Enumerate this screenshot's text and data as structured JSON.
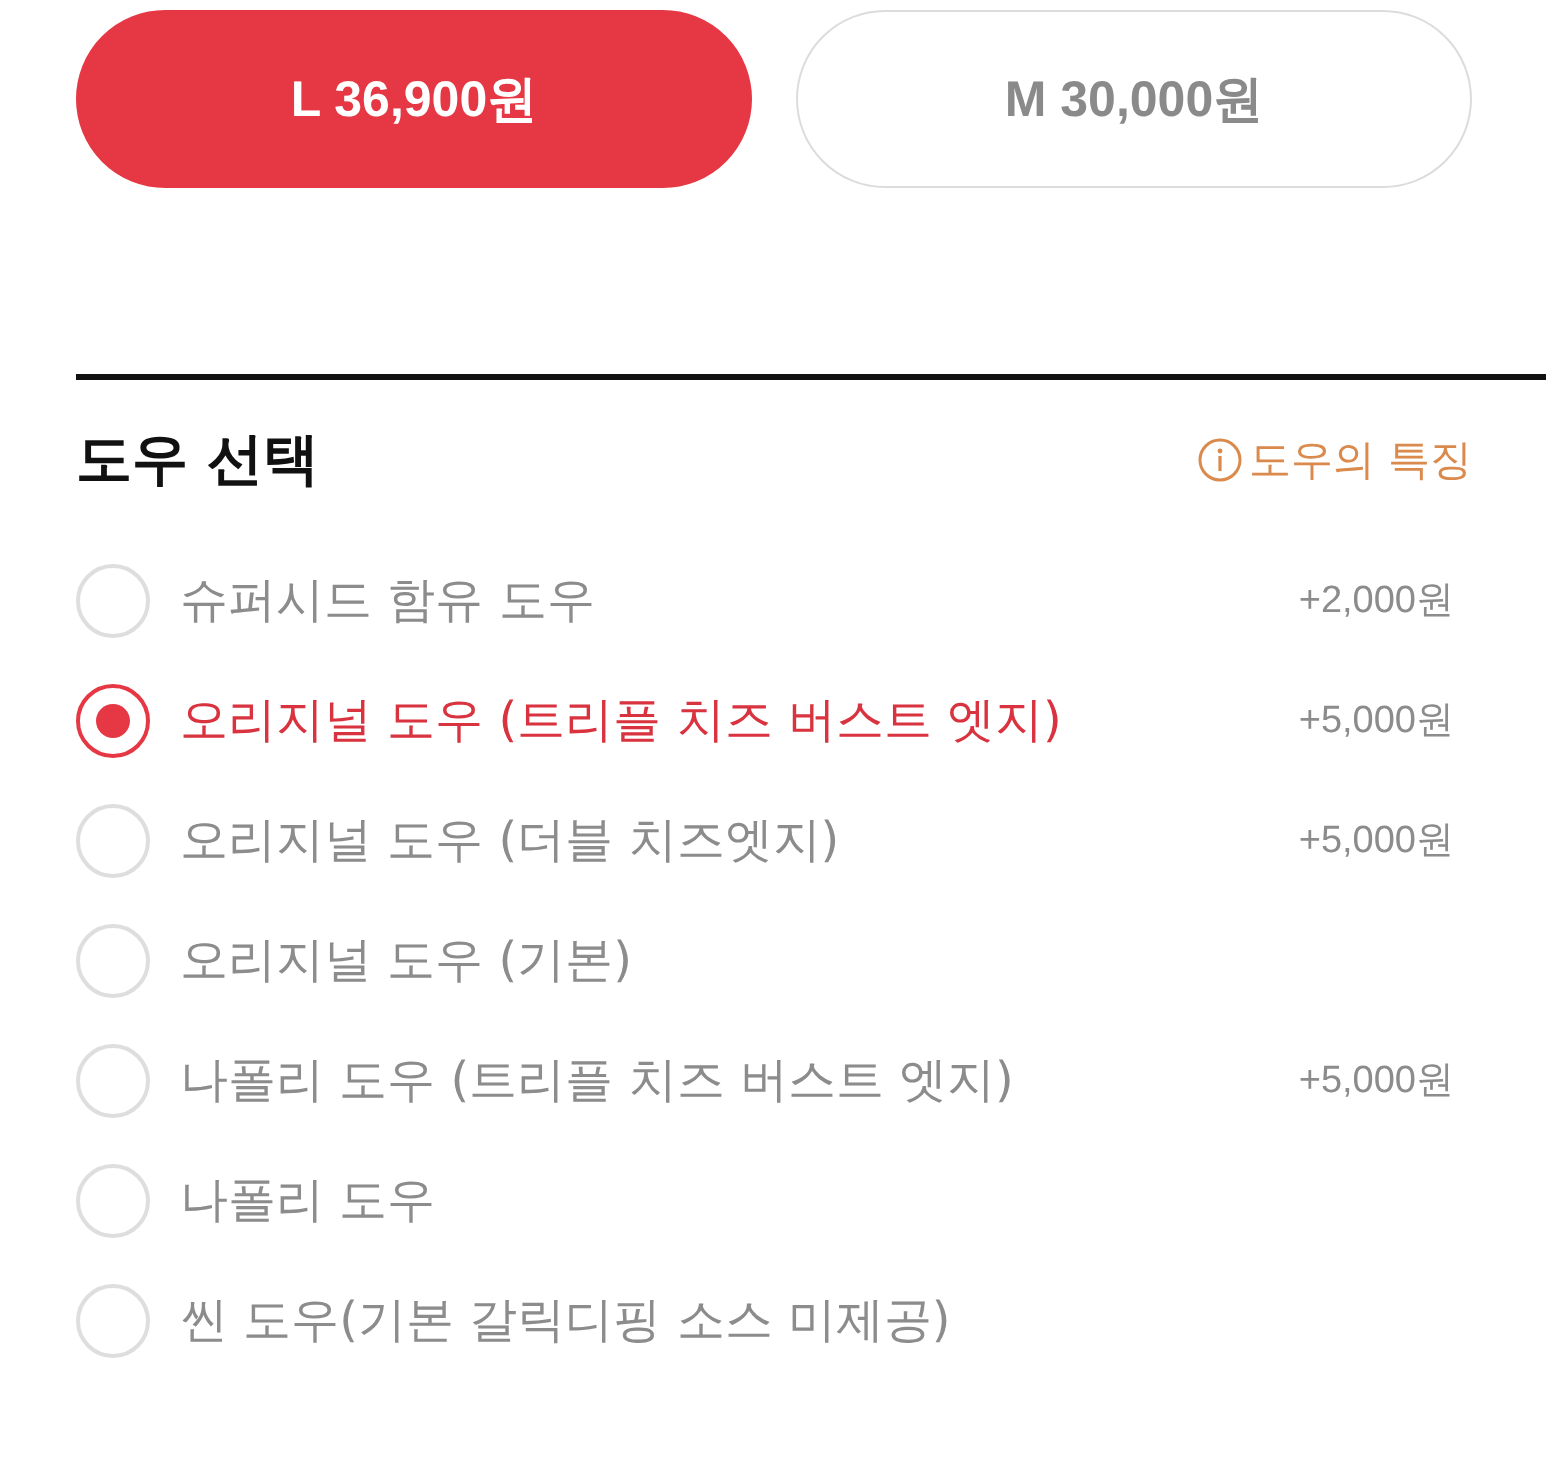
{
  "size_options": [
    {
      "label": "L 36,900원",
      "selected": true
    },
    {
      "label": "M 30,000원",
      "selected": false
    }
  ],
  "dough_section": {
    "title": "도우 선택",
    "info_link": "도우의 특징",
    "options": [
      {
        "label": "슈퍼시드 함유 도우",
        "price": "+2,000원",
        "selected": false
      },
      {
        "label": "오리지널 도우 (트리플 치즈 버스트 엣지)",
        "price": "+5,000원",
        "selected": true
      },
      {
        "label": "오리지널 도우 (더블 치즈엣지)",
        "price": "+5,000원",
        "selected": false
      },
      {
        "label": "오리지널 도우 (기본)",
        "selected": false
      },
      {
        "label": "나폴리 도우 (트리플 치즈 버스트 엣지)",
        "price": "+5,000원",
        "selected": false
      },
      {
        "label": "나폴리 도우",
        "selected": false
      },
      {
        "label": "씬 도우(기본 갈릭디핑 소스 미제공)",
        "selected": false
      }
    ]
  }
}
